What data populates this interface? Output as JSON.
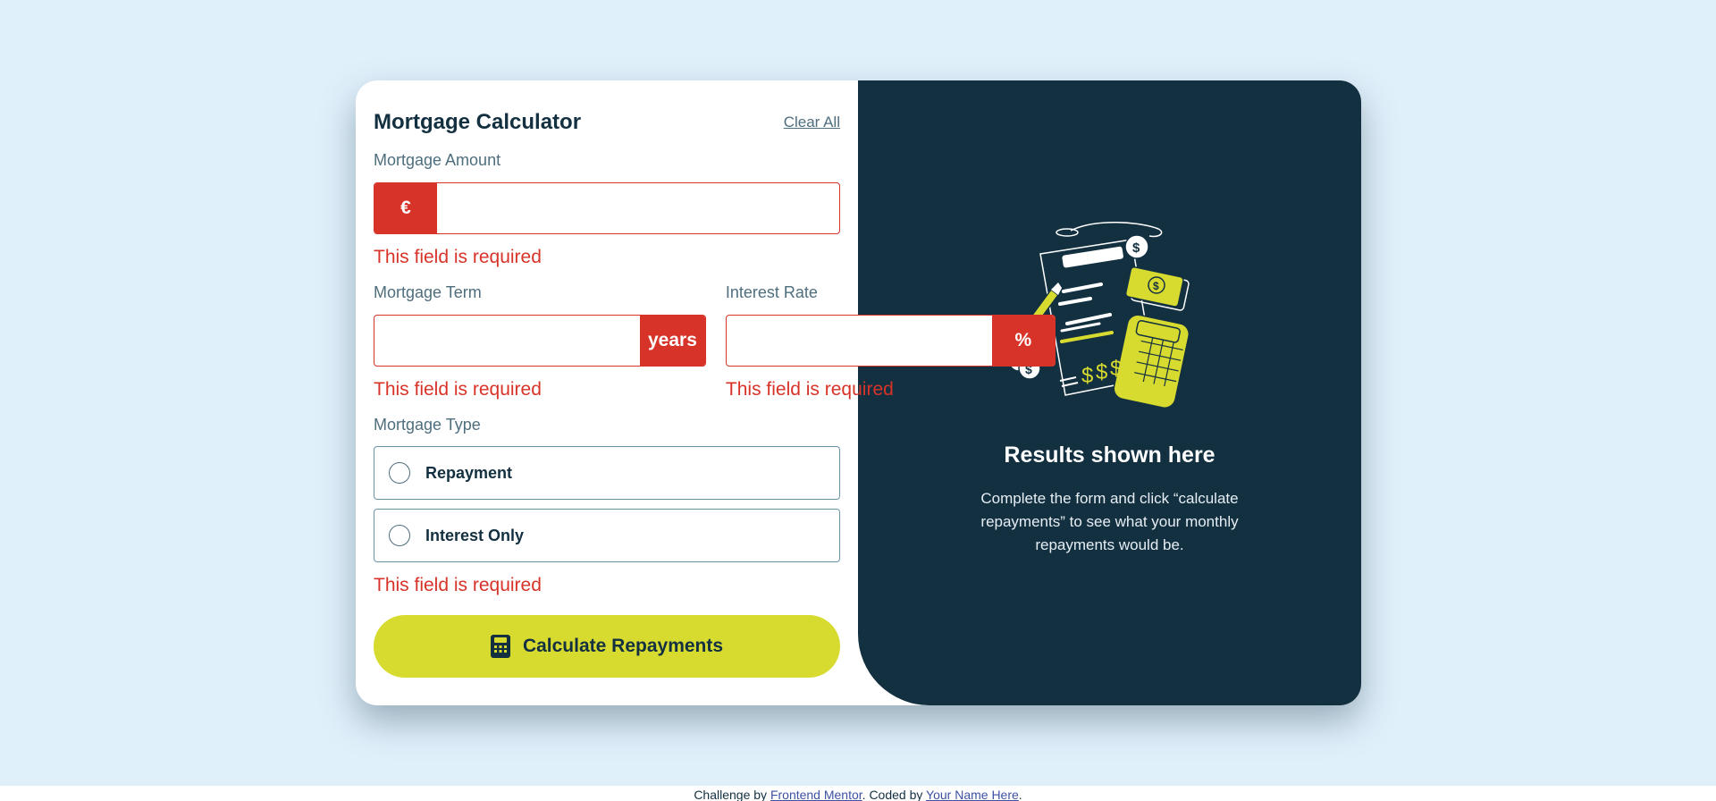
{
  "form": {
    "title": "Mortgage Calculator",
    "clear_all": "Clear All",
    "amount": {
      "label": "Mortgage Amount",
      "prefix": "€",
      "value": "",
      "error": "This field is required"
    },
    "term": {
      "label": "Mortgage Term",
      "suffix": "years",
      "value": "",
      "error": "This field is required"
    },
    "rate": {
      "label": "Interest Rate",
      "suffix": "%",
      "value": "",
      "error": "This field is required"
    },
    "type": {
      "label": "Mortgage Type",
      "options": [
        {
          "label": "Repayment",
          "selected": false
        },
        {
          "label": "Interest Only",
          "selected": false
        }
      ],
      "error": "This field is required"
    },
    "submit_label": "Calculate Repayments"
  },
  "results": {
    "title": "Results shown here",
    "text": "Complete the form and click “calculate repayments” to see what your monthly repayments would be."
  },
  "footer": {
    "prefix": "Challenge by ",
    "link1": "Frontend Mentor",
    "middle": ". Coded by ",
    "link2": "Your Name Here",
    "suffix": "."
  },
  "colors": {
    "background": "#e0f0fb",
    "dark": "#133041",
    "accent_lime": "#d8db2f",
    "error_red": "#d73328",
    "slate": "#4e6e7e"
  },
  "icons": {
    "button_icon": "calculator-icon",
    "illustration": "calculator-illustration"
  }
}
